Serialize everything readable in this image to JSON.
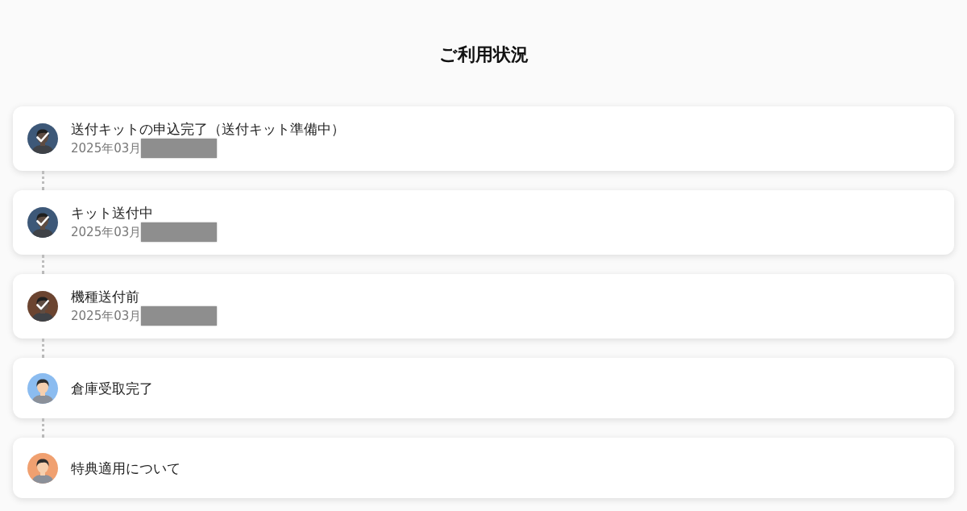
{
  "title": "ご利用状況",
  "steps": [
    {
      "label": "送付キットの申込完了（送付キット準備中）",
      "date": "2025年03月",
      "redacted": true,
      "completed": true,
      "color": "#3d5878"
    },
    {
      "label": "キット送付中",
      "date": "2025年03月",
      "redacted": true,
      "completed": true,
      "color": "#3d5878"
    },
    {
      "label": "機種送付前",
      "date": "2025年03月",
      "redacted": true,
      "completed": true,
      "color": "#6b4430"
    },
    {
      "label": "倉庫受取完了",
      "completed": false,
      "color": "#8bbcf0"
    },
    {
      "label": "特典適用について",
      "completed": false,
      "color": "#f0a070"
    }
  ]
}
